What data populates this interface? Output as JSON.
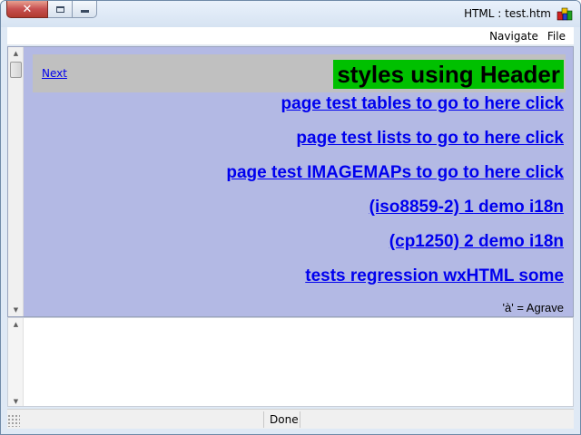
{
  "window": {
    "title": "HTML : test.htm",
    "caption_buttons": {
      "close": "✕"
    },
    "app_icon": "colored-cubes-icon"
  },
  "menubar": {
    "items": [
      {
        "label": "Navigate"
      },
      {
        "label": "File"
      }
    ]
  },
  "html_view": {
    "background_color": "#b3b9e4",
    "header": {
      "next_link": "Next",
      "title": "styles using Header",
      "title_bg_color": "#00c000",
      "table_bg_color": "#c0c0c0"
    },
    "links": [
      {
        "label": "page test tables to go to here click"
      },
      {
        "label": "page test lists to go to here click"
      },
      {
        "label": "page test IMAGEMAPs to go to here click"
      },
      {
        "label": "(iso8859-2) 1 demo i18n"
      },
      {
        "label": "(cp1250) 2 demo i18n"
      },
      {
        "label": "tests regression wxHTML some"
      }
    ],
    "footer_text": "'à' = Agrave",
    "link_color": "#0000ee"
  },
  "statusbar": {
    "status": "Done"
  }
}
